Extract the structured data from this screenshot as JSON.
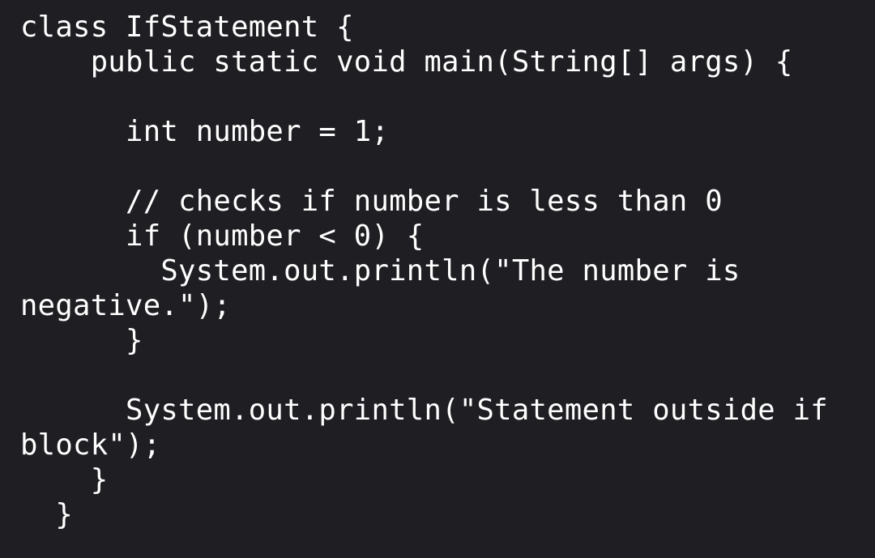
{
  "code": {
    "language": "java",
    "lines": [
      "class IfStatement {",
      "    public static void main(String[] args) {",
      "",
      "      int number = 1;",
      "",
      "      // checks if number is less than 0",
      "      if (number < 0) {",
      "        System.out.println(\"The number is",
      "negative.\");",
      "      }",
      "",
      "      System.out.println(\"Statement outside if",
      "block\");",
      "    }",
      "  }"
    ]
  },
  "colors": {
    "background": "#1f1e23",
    "text": "#ffffff"
  }
}
